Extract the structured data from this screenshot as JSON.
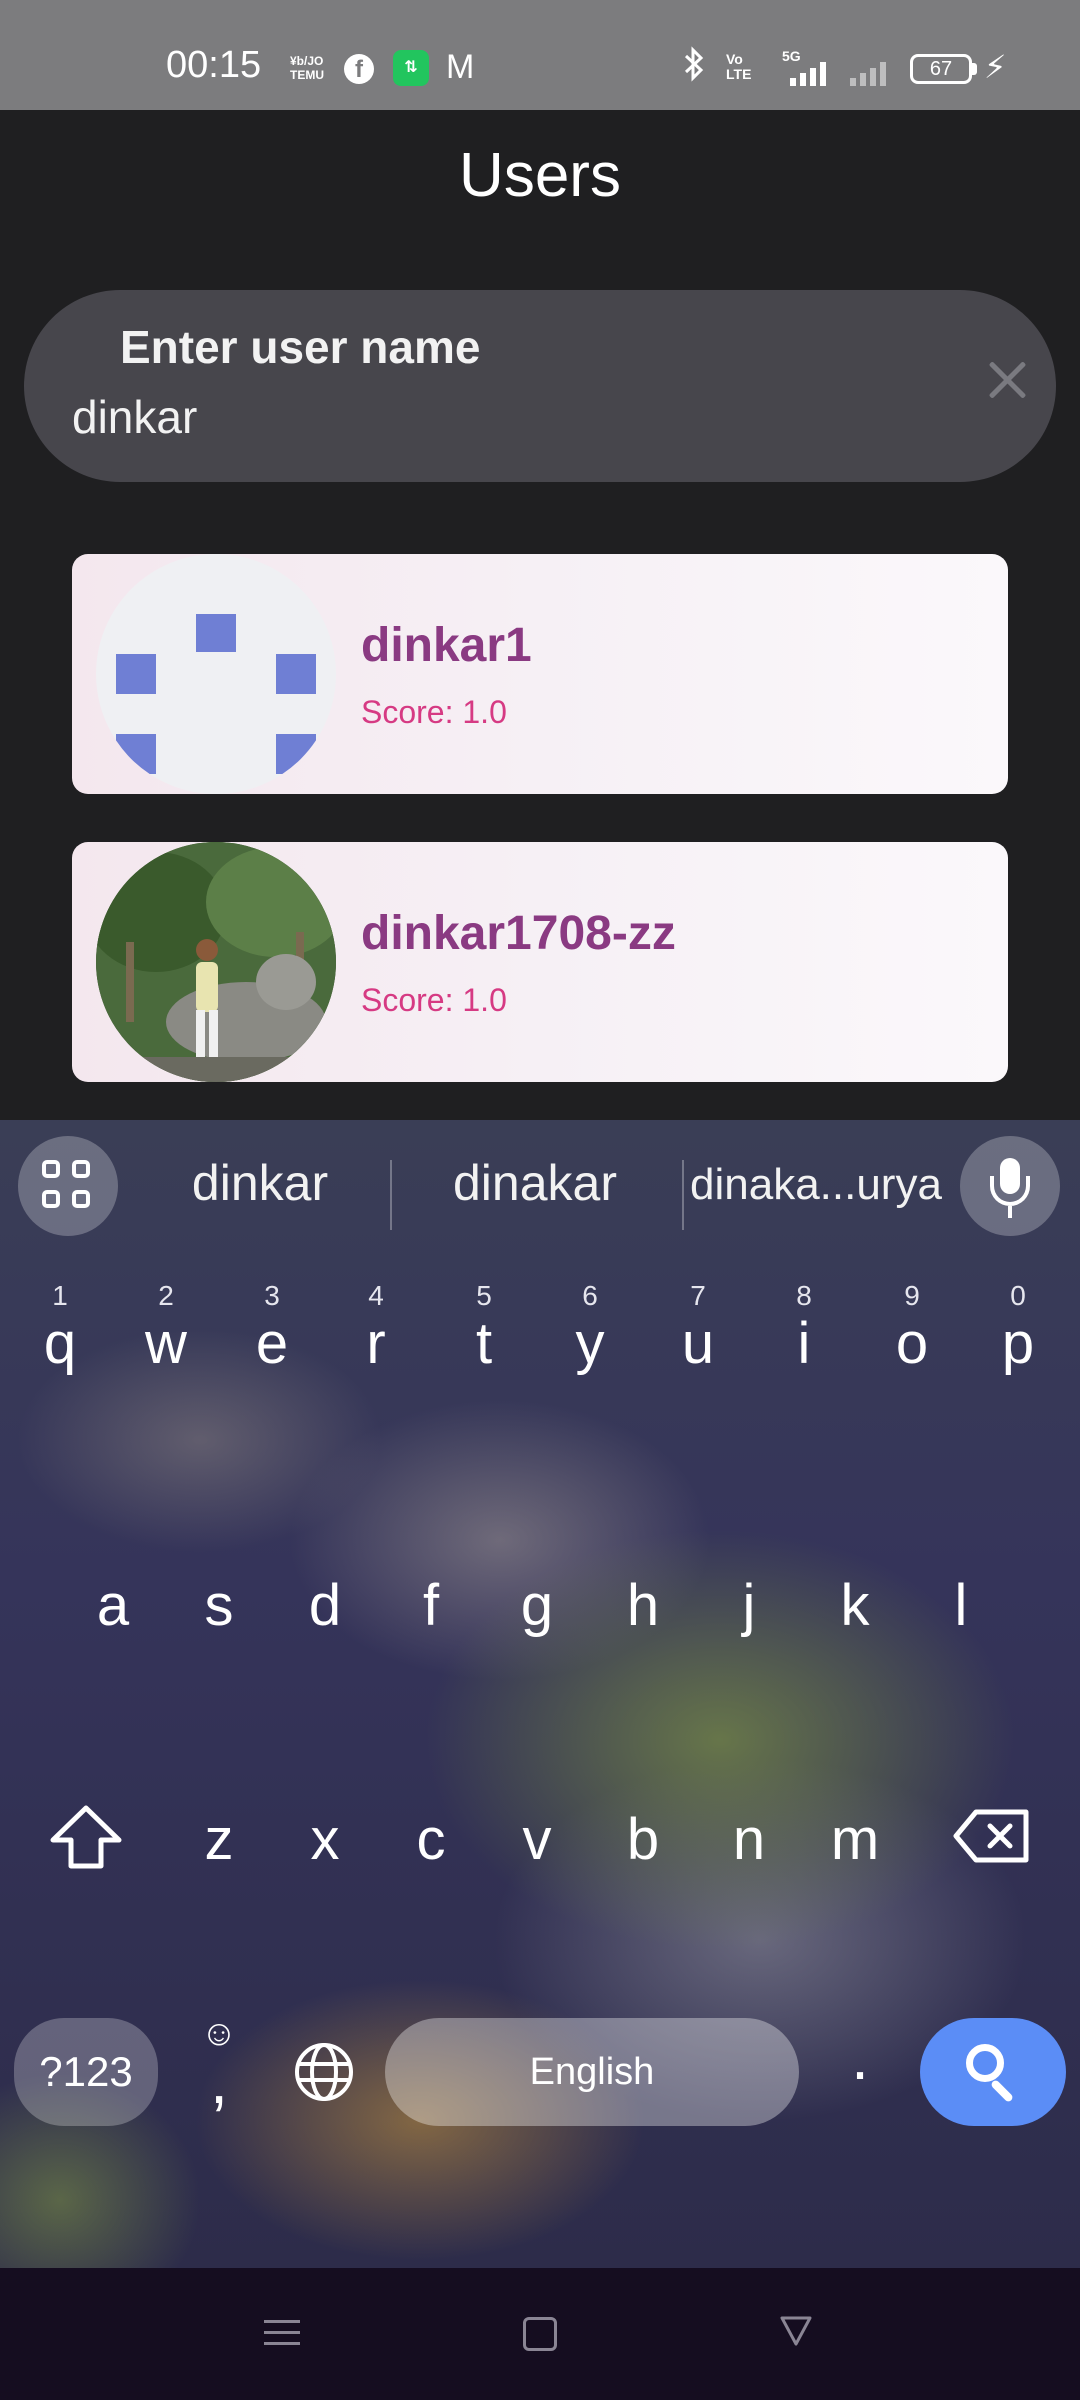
{
  "status_bar": {
    "time": "00:15",
    "notif_icon_1": "¥b/JO\nTEMU",
    "facebook_icon": "f",
    "green_app_icon": "⇅",
    "gmail_icon": "M",
    "volte": "Vo\nLTE",
    "network": "5G",
    "battery": "67",
    "icons": [
      "temu-icon",
      "facebook-icon",
      "data-transfer-icon",
      "gmail-icon",
      "bluetooth-icon",
      "volte-icon",
      "signal-5g-icon",
      "signal-icon",
      "battery-icon",
      "charging-icon"
    ]
  },
  "header": {
    "title": "Users"
  },
  "search": {
    "label": "Enter user name",
    "value": "dinkar"
  },
  "users": [
    {
      "name": "dinkar1",
      "score": "Score: 1.0",
      "avatar": "default-avatar"
    },
    {
      "name": "dinkar1708-zz",
      "score": "Score: 1.0",
      "avatar": "photo-avatar"
    }
  ],
  "keyboard": {
    "suggestions": [
      "dinkar",
      "dinakar",
      "dinaka...urya"
    ],
    "row1": [
      {
        "num": "1",
        "ch": "q"
      },
      {
        "num": "2",
        "ch": "w"
      },
      {
        "num": "3",
        "ch": "e"
      },
      {
        "num": "4",
        "ch": "r"
      },
      {
        "num": "5",
        "ch": "t"
      },
      {
        "num": "6",
        "ch": "y"
      },
      {
        "num": "7",
        "ch": "u"
      },
      {
        "num": "8",
        "ch": "i"
      },
      {
        "num": "9",
        "ch": "o"
      },
      {
        "num": "0",
        "ch": "p"
      }
    ],
    "row2": [
      "a",
      "s",
      "d",
      "f",
      "g",
      "h",
      "j",
      "k",
      "l"
    ],
    "row3": [
      "z",
      "x",
      "c",
      "v",
      "b",
      "n",
      "m"
    ],
    "symbols_label": "?123",
    "comma": ",",
    "period": ".",
    "space_label": "English",
    "emoji_glyph": "☺",
    "globe_glyph": "◎"
  },
  "colors": {
    "background": "#1f1f21",
    "status_bar": "#7c7c7e",
    "search_field": "#47464c",
    "user_name": "#8a3a82",
    "user_score": "#d63a83",
    "avatar_pattern": "#6f7fd4",
    "search_key": "#5b8df6"
  }
}
